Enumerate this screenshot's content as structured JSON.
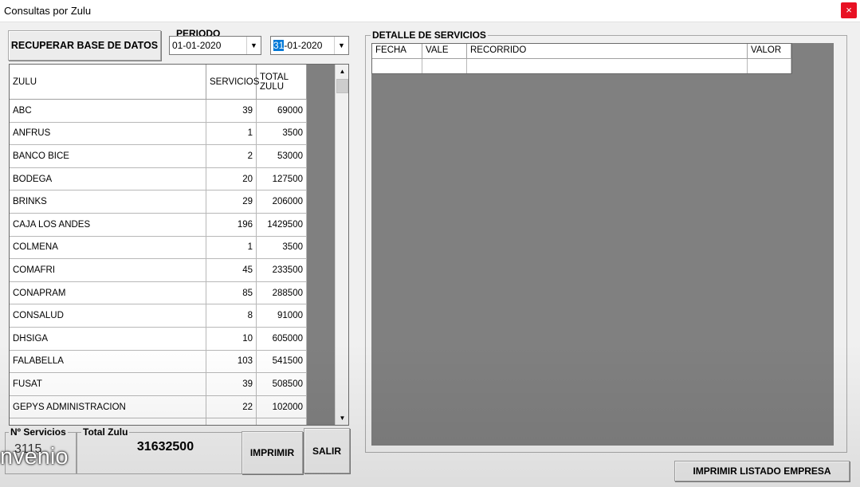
{
  "window": {
    "title": "Consultas por Zulu",
    "close": "×"
  },
  "buttons": {
    "recuperar": "RECUPERAR BASE DE DATOS",
    "imprimir": "IMPRIMIR",
    "salir": "SALIR",
    "listado": "IMPRIMIR LISTADO EMPRESA"
  },
  "periodo": {
    "label": "PERIODO",
    "desde": "01-01-2020",
    "hasta_day": "31",
    "hasta_rest": "-01-2020"
  },
  "zulu_grid": {
    "columns": [
      "ZULU",
      "SERVICIOS",
      "TOTAL ZULU"
    ],
    "rows": [
      [
        "ABC",
        "39",
        "69000"
      ],
      [
        "ANFRUS",
        "1",
        "3500"
      ],
      [
        "BANCO BICE",
        "2",
        "53000"
      ],
      [
        "BODEGA",
        "20",
        "127500"
      ],
      [
        "BRINKS",
        "29",
        "206000"
      ],
      [
        "CAJA LOS ANDES",
        "196",
        "1429500"
      ],
      [
        "COLMENA",
        "1",
        "3500"
      ],
      [
        "COMAFRI",
        "45",
        "233500"
      ],
      [
        "CONAPRAM",
        "85",
        "288500"
      ],
      [
        "CONSALUD",
        "8",
        "91000"
      ],
      [
        "DHSIGA",
        "10",
        "605000"
      ],
      [
        "FALABELLA",
        "103",
        "541500"
      ],
      [
        "FUSAT",
        "39",
        "508500"
      ],
      [
        "GEPYS ADMINISTRACION",
        "22",
        "102000"
      ],
      [
        "",
        "",
        ""
      ]
    ]
  },
  "totals": {
    "nserv_label": "Nº Servicios",
    "nserv_value": "3115",
    "total_label": "Total Zulu",
    "total_value": "31632500"
  },
  "detalle": {
    "label": "DETALLE DE SERVICIOS",
    "columns": [
      "FECHA",
      "VALE",
      "RECORRIDO",
      "VALOR"
    ]
  },
  "caption": "nvenio"
}
